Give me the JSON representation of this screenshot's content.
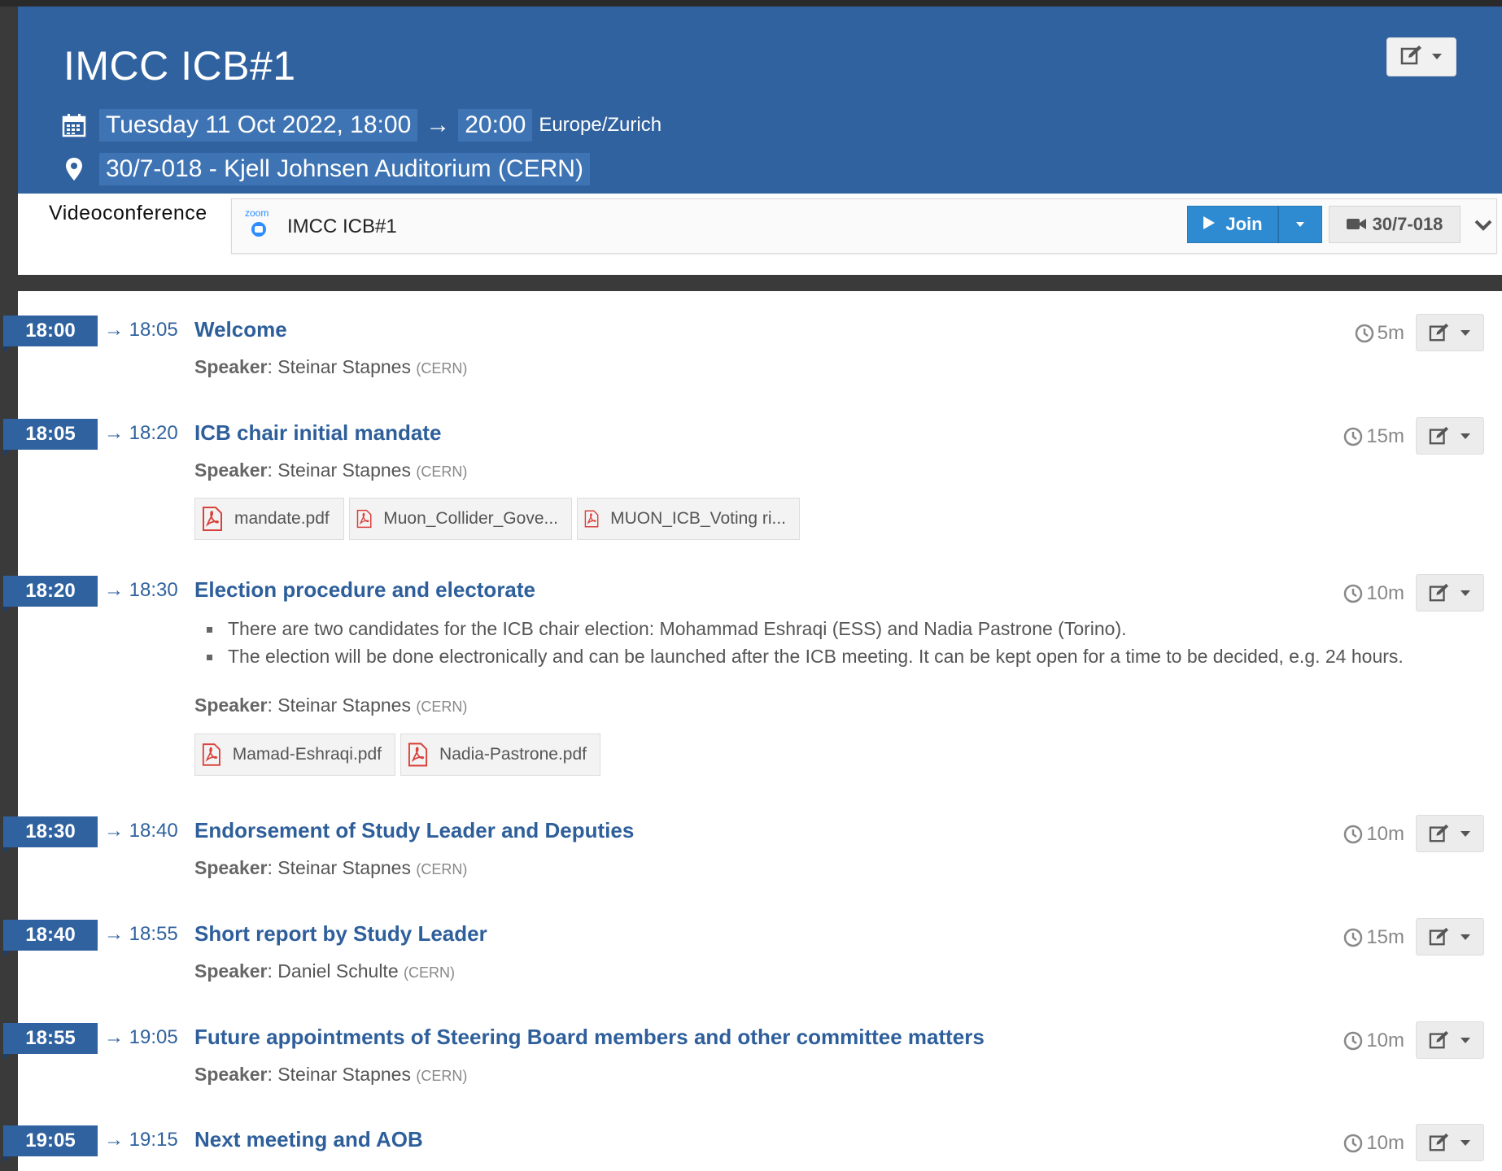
{
  "event": {
    "title": "IMCC ICB#1",
    "start": "Tuesday 11 Oct 2022, 18:00",
    "arrow": "→",
    "end": "20:00",
    "timezone": "Europe/Zurich",
    "location": "30/7-018 - Kjell Johnsen Auditorium (CERN)"
  },
  "videoconference": {
    "label": "Videoconference",
    "logo_text": "zoom",
    "name": "IMCC ICB#1",
    "join_label": "Join",
    "room_label": "30/7-018"
  },
  "labels": {
    "speaker": "Speaker",
    "arrow": "→"
  },
  "items": [
    {
      "start": "18:00",
      "end": "18:05",
      "title": "Welcome",
      "speaker": "Steinar Stapnes",
      "affiliation": "(CERN)",
      "duration": "5m"
    },
    {
      "start": "18:05",
      "end": "18:20",
      "title": "ICB chair initial mandate",
      "speaker": "Steinar Stapnes",
      "affiliation": "(CERN)",
      "duration": "15m",
      "attachments": [
        "mandate.pdf",
        "Muon_Collider_Gove...",
        "MUON_ICB_Voting ri..."
      ]
    },
    {
      "start": "18:20",
      "end": "18:30",
      "title": "Election procedure and electorate",
      "speaker": "Steinar Stapnes",
      "affiliation": "(CERN)",
      "duration": "10m",
      "description": [
        "There are two candidates for the ICB chair election: Mohammad Eshraqi (ESS) and Nadia Pastrone (Torino).",
        "The election will be done electronically and can be launched after the ICB meeting. It can be kept open for a time to be decided, e.g. 24 hours."
      ],
      "attachments": [
        "Mamad-Eshraqi.pdf",
        "Nadia-Pastrone.pdf"
      ]
    },
    {
      "start": "18:30",
      "end": "18:40",
      "title": "Endorsement of Study Leader and Deputies",
      "speaker": "Steinar Stapnes",
      "affiliation": "(CERN)",
      "duration": "10m"
    },
    {
      "start": "18:40",
      "end": "18:55",
      "title": "Short report by Study Leader",
      "speaker": "Daniel Schulte",
      "affiliation": "(CERN)",
      "duration": "15m"
    },
    {
      "start": "18:55",
      "end": "19:05",
      "title": "Future appointments of Steering Board members and other committee matters",
      "speaker": "Steinar Stapnes",
      "affiliation": "(CERN)",
      "duration": "10m"
    },
    {
      "start": "19:05",
      "end": "19:15",
      "title": "Next meeting and AOB",
      "duration": "10m"
    }
  ],
  "colors": {
    "header_bg": "#30629f",
    "highlight_bg": "#3f74b4",
    "title_link": "#2e5f9b",
    "join_button": "#2e8bd1",
    "pdf_red": "#d9413b"
  },
  "icons": {
    "calendar": "calendar-icon",
    "location": "map-pin-icon",
    "edit": "edit-icon",
    "caret": "caret-down-icon",
    "clock": "clock-icon",
    "pdf": "pdf-file-icon",
    "play": "play-icon",
    "camera": "video-camera-icon",
    "chevron": "chevron-down-icon"
  }
}
